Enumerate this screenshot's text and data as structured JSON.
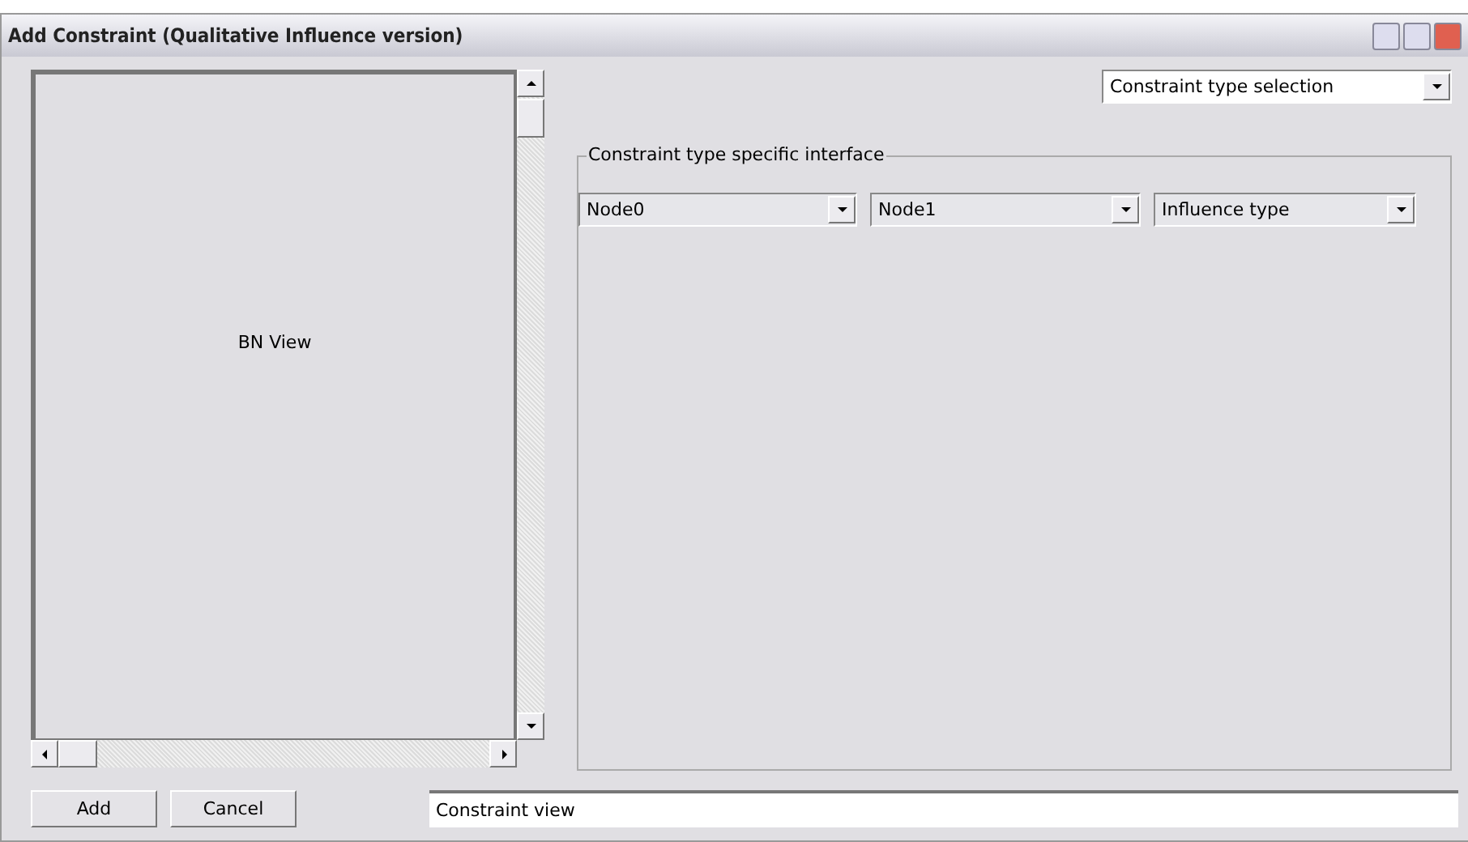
{
  "window": {
    "title": "Add Constraint (Qualitative Influence version)"
  },
  "bn_view": {
    "label": "BN View"
  },
  "type_selection": {
    "value": "Constraint type selection"
  },
  "group": {
    "title": "Constraint type specific interface",
    "combos": [
      {
        "value": "Node0"
      },
      {
        "value": "Node1"
      },
      {
        "value": "Influence type"
      }
    ]
  },
  "buttons": [
    "Add",
    "Cancel"
  ],
  "constraint_view": {
    "value": "Constraint view"
  }
}
